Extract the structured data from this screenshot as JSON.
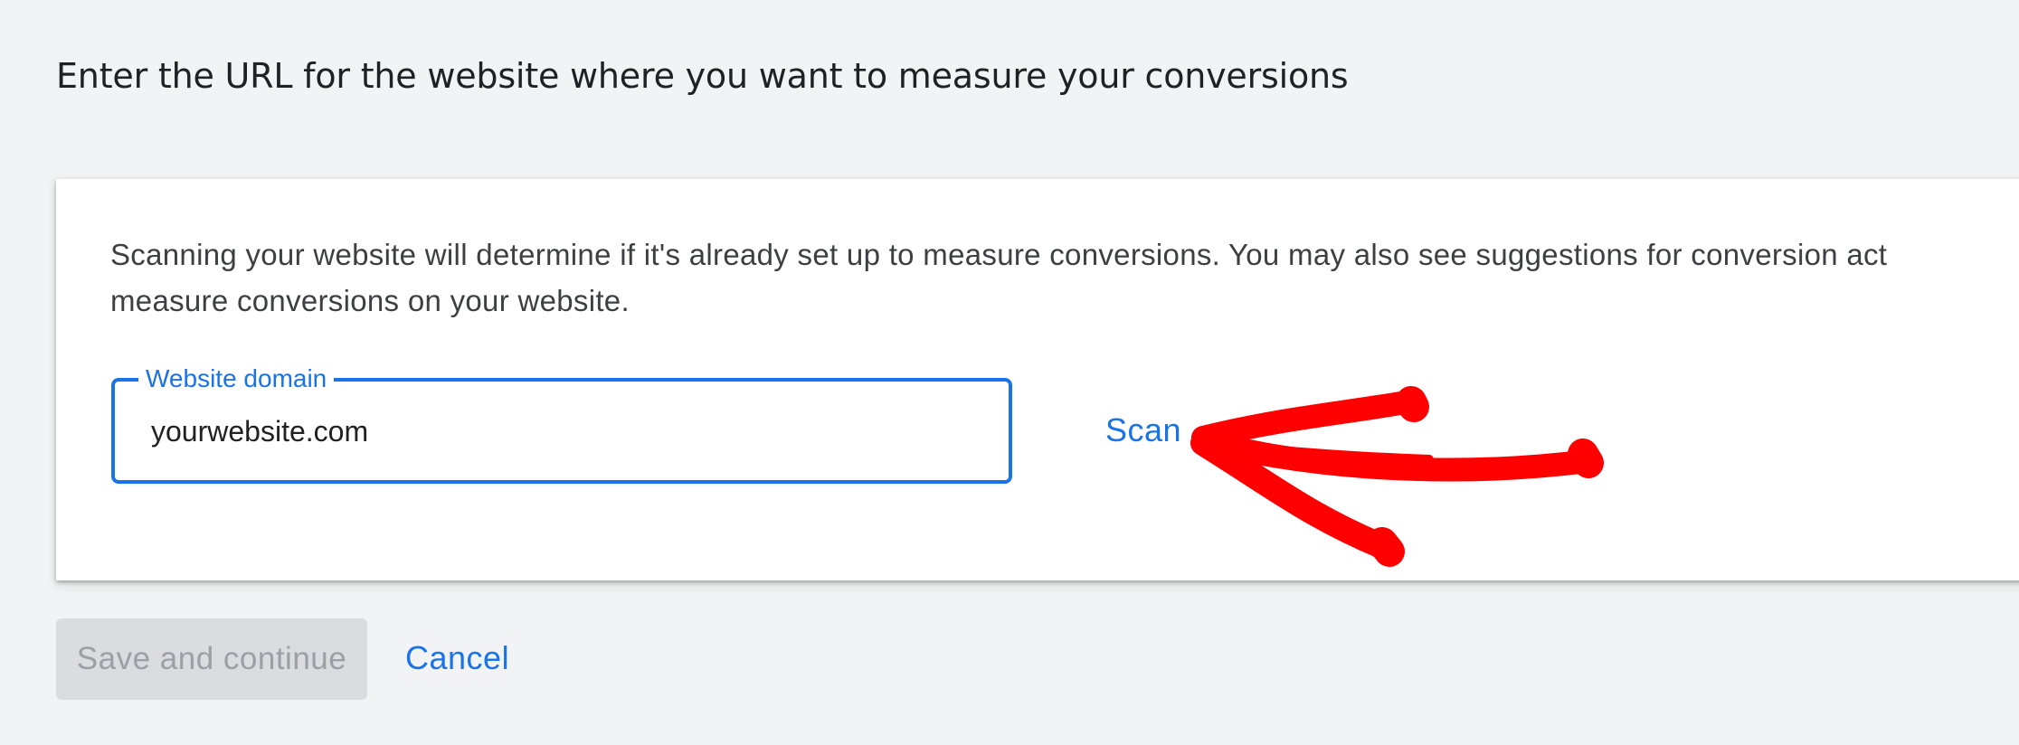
{
  "page": {
    "heading": "Enter the URL for the website where you want to measure your conversions"
  },
  "card": {
    "description": "Scanning your website will determine if it's already set up to measure conversions. You may also see suggestions for conversion act\nmeasure conversions on your website."
  },
  "domain_field": {
    "label": "Website domain",
    "value": "yourwebsite.com"
  },
  "scan": {
    "label": "Scan"
  },
  "footer": {
    "save_label": "Save and continue",
    "cancel_label": "Cancel"
  },
  "colors": {
    "accent": "#1a73e8",
    "page_background": "#f1f3f4",
    "card_background": "#ffffff",
    "disabled_button": "#dadce0",
    "disabled_text": "#9aa0a6",
    "annotation_arrow": "#ff0000"
  },
  "icons": {
    "annotation": "hand-drawn-arrow-icon"
  }
}
